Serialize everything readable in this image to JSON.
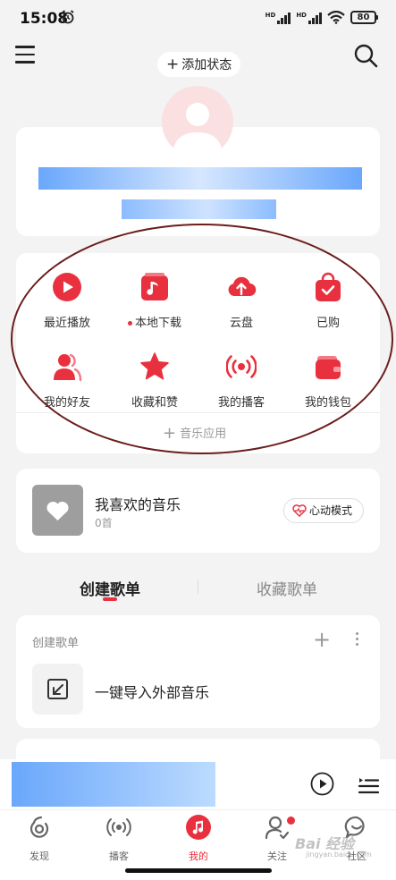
{
  "status_bar": {
    "time": "15:08",
    "sig1": "HD",
    "sig2": "HD",
    "battery": "80"
  },
  "header": {
    "add_status": "添加状态"
  },
  "apps": [
    {
      "label": "最近播放",
      "icon": "play-circle-icon"
    },
    {
      "label": "本地下载",
      "icon": "music-note-icon",
      "dot": true
    },
    {
      "label": "云盘",
      "icon": "cloud-upload-icon"
    },
    {
      "label": "已购",
      "icon": "shopping-bag-icon"
    },
    {
      "label": "我的好友",
      "icon": "friends-icon"
    },
    {
      "label": "收藏和赞",
      "icon": "star-icon"
    },
    {
      "label": "我的播客",
      "icon": "podcast-icon"
    },
    {
      "label": "我的钱包",
      "icon": "wallet-icon"
    }
  ],
  "music_apps": "音乐应用",
  "liked": {
    "title": "我喜欢的音乐",
    "count": "0首",
    "mode_button": "心动模式"
  },
  "tabs": [
    "创建歌单",
    "收藏歌单"
  ],
  "playlist": {
    "header": "创建歌单",
    "import_label": "一键导入外部音乐"
  },
  "bottom_nav": [
    {
      "label": "发现",
      "icon": "discover-icon"
    },
    {
      "label": "播客",
      "icon": "podcast-icon"
    },
    {
      "label": "我的",
      "icon": "music-icon",
      "active": true
    },
    {
      "label": "关注",
      "icon": "follow-icon",
      "badge": true
    },
    {
      "label": "社区",
      "icon": "community-icon"
    }
  ],
  "watermark": {
    "text": "Bai 经验",
    "sub": "jingyan.baidu.com"
  },
  "colors": {
    "accent": "#e8303f",
    "background": "#f3f3f3"
  }
}
